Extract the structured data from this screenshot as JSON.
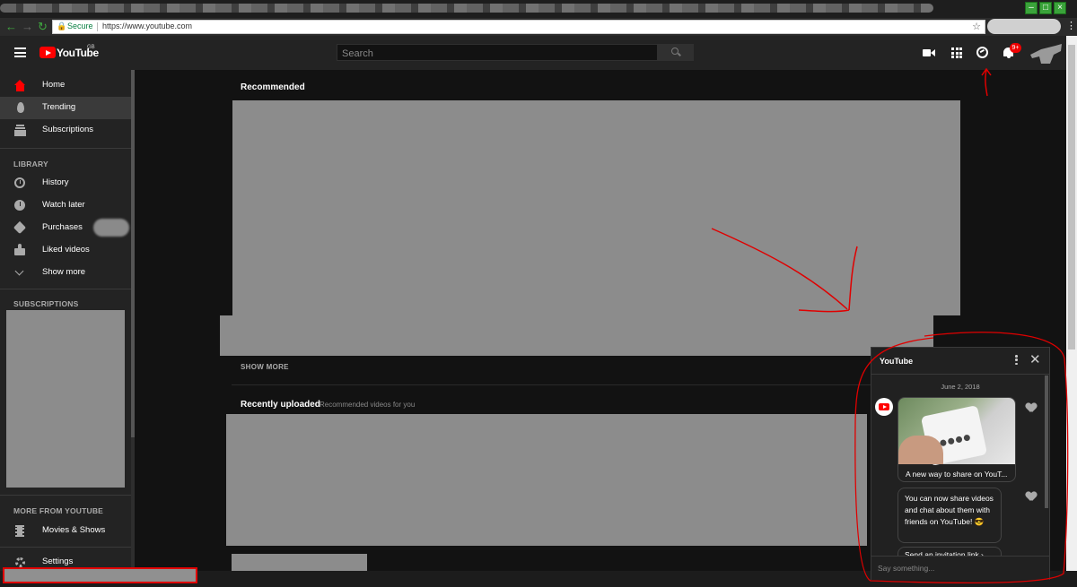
{
  "browser": {
    "secure_label": "Secure",
    "url": "https://www.youtube.com"
  },
  "masthead": {
    "logo_text": "YouTube",
    "region": "GB",
    "search_placeholder": "Search",
    "notification_count": "9+"
  },
  "sidebar": {
    "items": [
      {
        "label": "Home"
      },
      {
        "label": "Trending"
      },
      {
        "label": "Subscriptions"
      }
    ],
    "library_heading": "LIBRARY",
    "library": [
      {
        "label": "History"
      },
      {
        "label": "Watch later"
      },
      {
        "label": "Purchases"
      },
      {
        "label": "Liked videos"
      },
      {
        "label": "Show more"
      }
    ],
    "subscriptions_heading": "SUBSCRIPTIONS",
    "more_heading": "MORE FROM YOUTUBE",
    "more": [
      {
        "label": "Movies & Shows"
      },
      {
        "label": "Settings"
      }
    ]
  },
  "main": {
    "recommended_title": "Recommended",
    "show_more": "SHOW MORE",
    "recent_title": "Recently uploaded",
    "recent_subtitle": "Recommended videos for you"
  },
  "chat": {
    "title": "YouTube",
    "date": "June 2, 2018",
    "card_caption": "A new way to share on YouT...",
    "message": "You can now share videos and chat about them with friends on YouTube! 😎",
    "partial_message": "Send an invitation link ›",
    "input_placeholder": "Say something..."
  },
  "colors": {
    "accent": "#ff0000",
    "background": "#121212",
    "sidebar": "#232323",
    "annotation": "#e00000"
  }
}
